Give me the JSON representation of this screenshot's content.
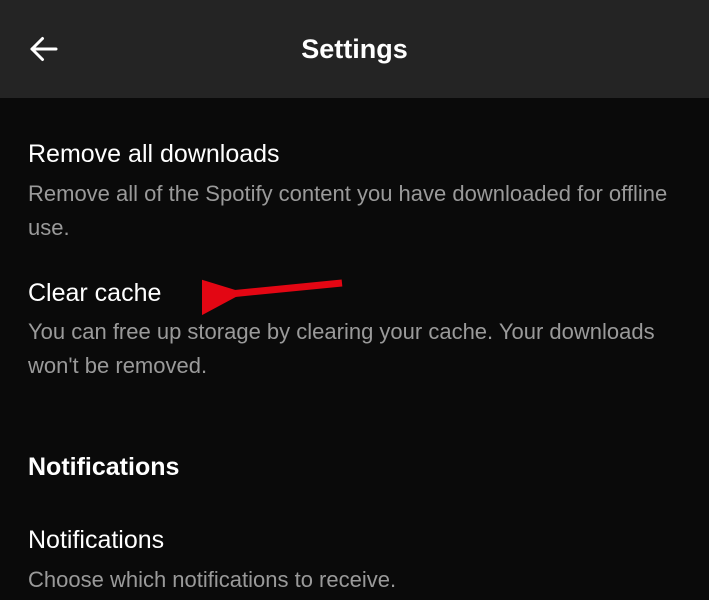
{
  "header": {
    "title": "Settings"
  },
  "settings": {
    "remove_downloads": {
      "title": "Remove all downloads",
      "description": "Remove all of the Spotify content you have downloaded for offline use."
    },
    "clear_cache": {
      "title": "Clear cache",
      "description": "You can free up storage by clearing your cache. Your downloads won't be removed."
    }
  },
  "sections": {
    "notifications": {
      "header": "Notifications",
      "items": {
        "notifications": {
          "title": "Notifications",
          "description": "Choose which notifications to receive."
        }
      }
    }
  },
  "annotation": {
    "arrow_color": "#e30613"
  }
}
